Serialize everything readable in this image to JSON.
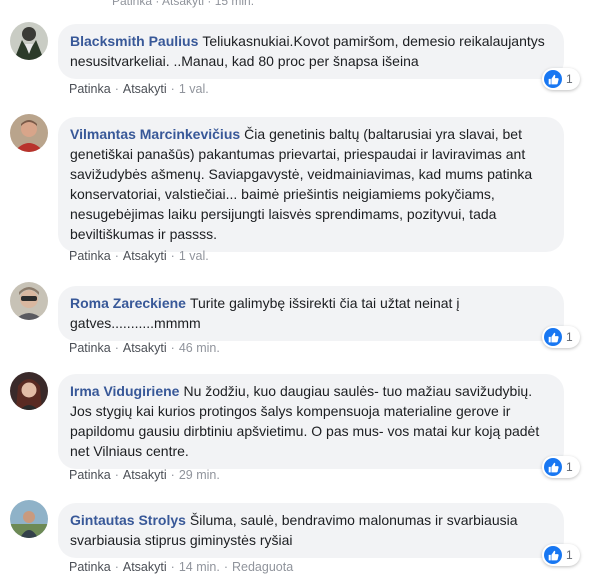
{
  "top_cut": "Patinka · Atsakyti · 15 min.",
  "labels": {
    "like": "Patinka",
    "reply": "Atsakyti",
    "dot": "·"
  },
  "comments": [
    {
      "author": "Blacksmith Paulius",
      "text": "Teliukasnukiai.Kovot pamiršom, demesio reikalaujantys nesusitvarkeliai. ..Manau, kad 80 proc per šnapsa išeina",
      "time": "1 val.",
      "reactions": "1",
      "avatar": "dark-suit-avatar"
    },
    {
      "author": "Vilmantas Marcinkevičius",
      "text": "Čia genetinis baltų (baltarusiai yra slavai, bet genetiškai panašūs) pakantumas prievartai, priespaudai ir laviravimas ant savižudybės ašmenų. Saviapgavystė, veidmainiavimas, kad mums patinka konservatoriai, valstiečiai... baimė priešintis neigiamiems pokyčiams, nesugebėjimas laiku persijungti laisvės sprendimams, pozityvui, tada beviltiškumas ir passss.",
      "time": "1 val.",
      "reactions": "",
      "avatar": "man-portrait-avatar"
    },
    {
      "author": "Roma Zareckiene",
      "text": "Turite galimybę išsirekti čia tai užtat neinat į gatves...........mmmm",
      "time": "46 min.",
      "reactions": "1",
      "avatar": "woman-sunglasses-avatar"
    },
    {
      "author": "Irma Vidugiriene",
      "text": "Nu žodžiu, kuo daugiau saulės- tuo mažiau savižudybių. Jos stygių kai kurios protingos šalys kompensuoja materialine gerove ir papildomu gausiu dirbtiniu apšvietimu. O pas mus- vos matai kur koją padėt net Vilniaus centre.",
      "time": "29 min.",
      "reactions": "1",
      "avatar": "woman-portrait-avatar"
    },
    {
      "author": "Gintautas Strolys",
      "text": "Šiluma, saulė, bendravimo malonumas ir svarbiausia svarbiausia stiprus giminystės ryšiai",
      "time": "14 min.",
      "edited": "Redaguota",
      "reactions": "1",
      "avatar": "man-outdoor-avatar"
    }
  ]
}
